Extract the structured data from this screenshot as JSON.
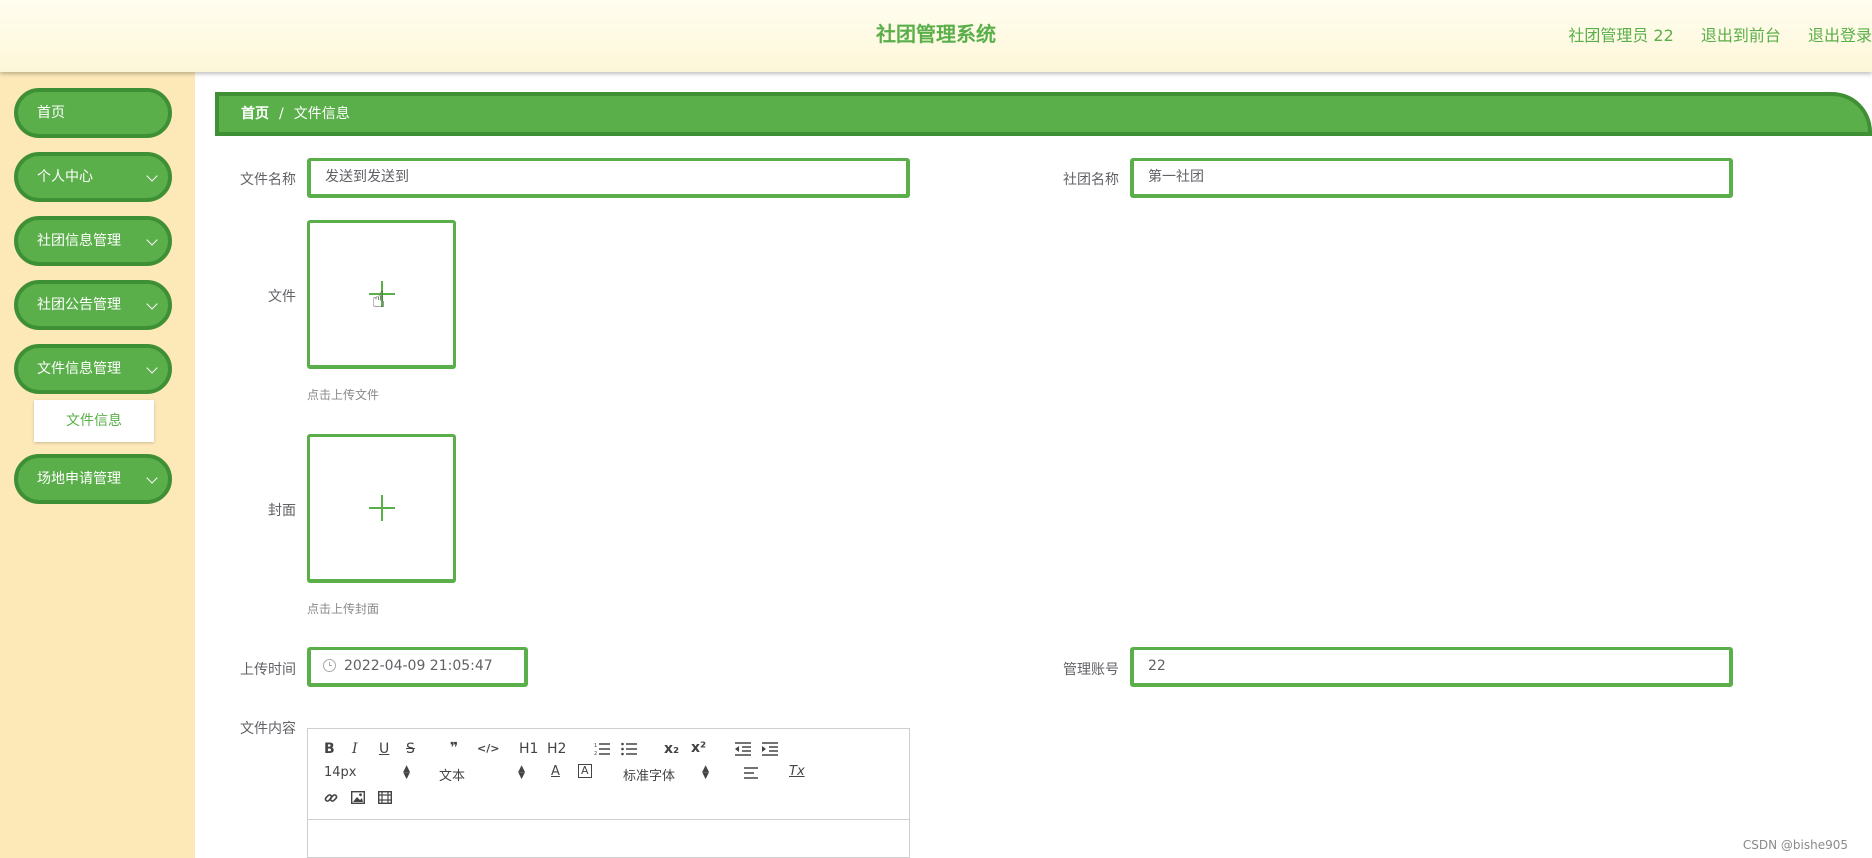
{
  "header": {
    "title": "社团管理系统",
    "user": "社团管理员 22",
    "front": "退出到前台",
    "logout": "退出登录"
  },
  "sidebar": {
    "items": [
      {
        "label": "首页"
      },
      {
        "label": "个人中心"
      },
      {
        "label": "社团信息管理"
      },
      {
        "label": "社团公告管理"
      },
      {
        "label": "文件信息管理"
      },
      {
        "label": "场地申请管理"
      }
    ],
    "submenu": "文件信息"
  },
  "breadcrumb": {
    "home": "首页",
    "separator": "/",
    "current": "文件信息"
  },
  "form": {
    "file_name_label": "文件名称",
    "file_name_value": "发送到发送到",
    "club_name_label": "社团名称",
    "club_name_value": "第一社团",
    "file_label": "文件",
    "file_hint": "点击上传文件",
    "cover_label": "封面",
    "cover_hint": "点击上传封面",
    "upload_time_label": "上传时间",
    "upload_time_value": "2022-04-09 21:05:47",
    "account_label": "管理账号",
    "account_value": "22",
    "content_label": "文件内容"
  },
  "editor": {
    "font_size": "14px",
    "format": "文本",
    "font_family": "标准字体",
    "buttons": {
      "bold": "B",
      "italic": "I",
      "underline": "U",
      "strike": "S",
      "quote": "❞",
      "code": "</>",
      "h1": "H1",
      "h2": "H2",
      "sub": "x₂",
      "sup": "x²",
      "text_color": "A",
      "bg_color": "A",
      "clear": "Tx"
    }
  },
  "watermark": "CSDN @bishe905",
  "colors": {
    "accent": "#5aaf4a",
    "accent_dark": "#3f8f35",
    "sidebar_bg": "#fde9b8"
  }
}
